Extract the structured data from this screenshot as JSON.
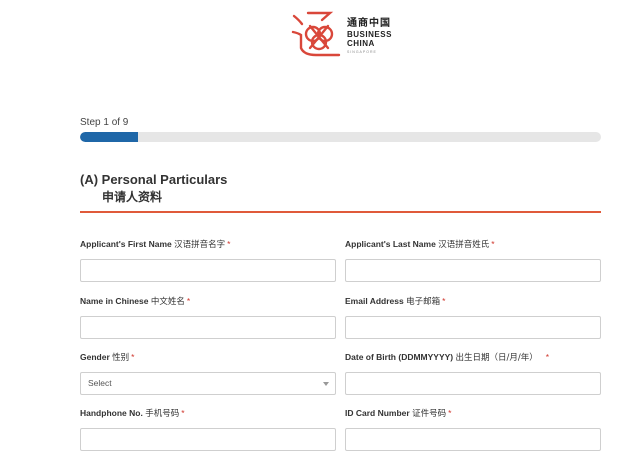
{
  "brand": {
    "name_cn": "通商中国",
    "name_en_line1": "BUSINESS",
    "name_en_line2": "CHINA",
    "tagline": "SINGAPORE",
    "colors": {
      "logo": "#d9473a",
      "progress": "#1f67a8",
      "rule": "#e05a3a",
      "required": "#d0362c"
    }
  },
  "progress": {
    "step_text": "Step 1 of 9",
    "current_step": 1,
    "total_steps": 9,
    "fill_fraction": 0.111
  },
  "section": {
    "title": "(A) Personal Particulars",
    "title_cn": "申请人资料"
  },
  "fields": [
    {
      "label": "Applicant's First Name",
      "label_cn": "汉语拼音名字",
      "required_mark": "*",
      "value": ""
    },
    {
      "label": "Applicant's Last Name",
      "label_cn": "汉语拼音姓氏",
      "required_mark": "*",
      "value": ""
    },
    {
      "label": "Name in Chinese",
      "label_cn": "中文姓名",
      "required_mark": "*",
      "value": ""
    },
    {
      "label": "Email Address",
      "label_cn": "电子邮箱",
      "required_mark": "*",
      "value": ""
    },
    {
      "label": "Gender",
      "label_cn": "性别",
      "required_mark": "*",
      "value": "Select"
    },
    {
      "label": "Date of Birth (DDMMYYYY)",
      "label_cn": "出生日期（日/月/年）",
      "required_mark": "*",
      "value": ""
    },
    {
      "label": "Handphone No.",
      "label_cn": "手机号码",
      "required_mark": "*",
      "value": ""
    },
    {
      "label": "ID Card Number",
      "label_cn": "证件号码",
      "required_mark": "*",
      "value": ""
    }
  ]
}
